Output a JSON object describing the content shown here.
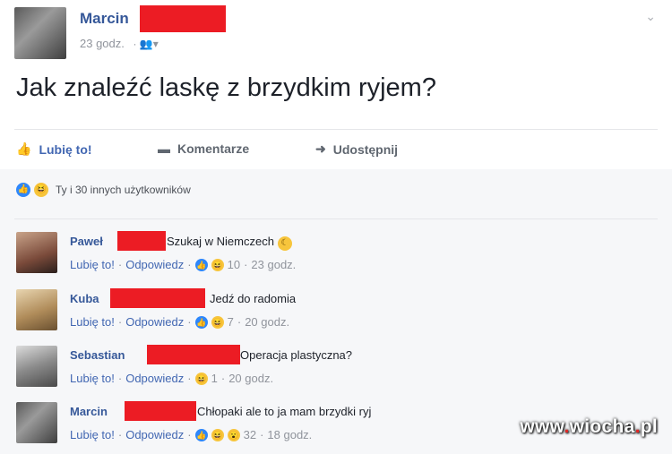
{
  "post": {
    "author": "Marcin",
    "time": "23 godz.",
    "privacy_icon": "friends-icon",
    "text": "Jak znaleźć laskę z brzydkim ryjem?"
  },
  "actions": {
    "like": "Lubię to!",
    "comment": "Komentarze",
    "share": "Udostępnij"
  },
  "reactions_summary": "Ty i 30 innych użytkowników",
  "comment_meta": {
    "like": "Lubię to!",
    "reply": "Odpowiedz"
  },
  "comments": [
    {
      "name": "Paweł",
      "text": "Szukaj w Niemczech",
      "count": "10",
      "time": "23 godz."
    },
    {
      "name": "Kuba",
      "text": "Jedź do radomia",
      "count": "7",
      "time": "20 godz."
    },
    {
      "name": "Sebastian",
      "text": "Operacja plastyczna?",
      "count": "1",
      "time": "20 godz."
    },
    {
      "name": "Marcin",
      "text": "Chłopaki ale to ja mam brzydki ryj",
      "count": "32",
      "time": "18 godz."
    }
  ],
  "watermark": {
    "prefix": "www",
    "domain": "wiocha",
    "tld": "pl"
  },
  "colors": {
    "redaction": "#ec1c24",
    "link": "#365899",
    "accent": "#4267b2"
  }
}
